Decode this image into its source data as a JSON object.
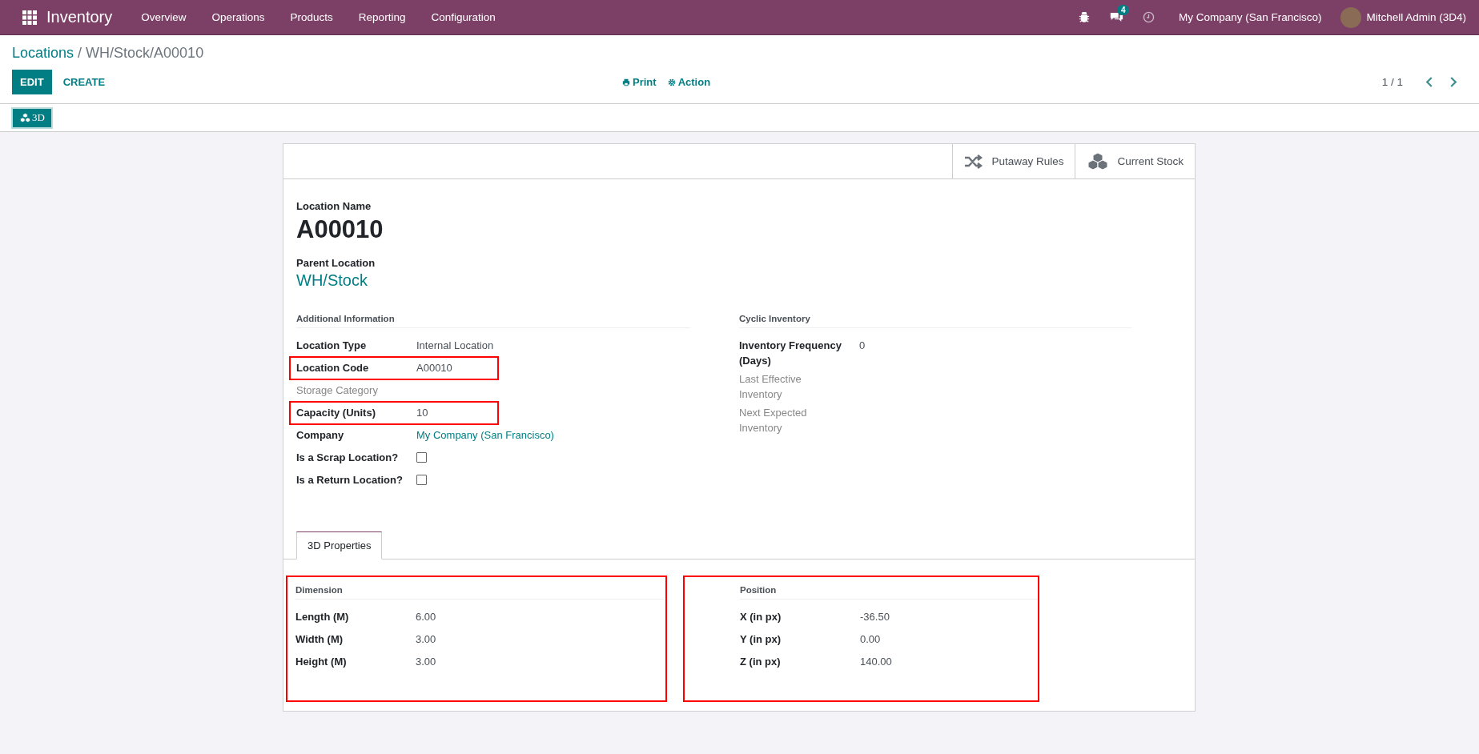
{
  "navbar": {
    "app_title": "Inventory",
    "menu": [
      "Overview",
      "Operations",
      "Products",
      "Reporting",
      "Configuration"
    ],
    "messages_count": "4",
    "company": "My Company (San Francisco)",
    "user": "Mitchell Admin (3D4)"
  },
  "breadcrumb": {
    "parent": "Locations",
    "separator": "/",
    "current": "WH/Stock/A00010"
  },
  "control_panel": {
    "buttons": [
      {
        "label": "EDIT",
        "kind": "primary"
      },
      {
        "label": "CREATE",
        "kind": "link"
      }
    ],
    "actions": [
      {
        "label": "Print",
        "kind": "print"
      },
      {
        "label": "Action",
        "kind": "gear"
      }
    ],
    "pager": "1 / 1"
  },
  "view_switch": {
    "label": "3D",
    "selected": true
  },
  "smart_buttons": [
    {
      "label": "Putaway Rules",
      "kind": "shuffle"
    },
    {
      "label": "Current Stock",
      "kind": "cubes"
    }
  ],
  "form": {
    "name_label": "Location Name",
    "name": "A00010",
    "parent_label": "Parent Location",
    "parent": "WH/Stock",
    "groups": [
      {
        "title": "Additional Information",
        "fields": [
          {
            "kind": "text",
            "label": "Location Type",
            "value": "Internal Location",
            "highlighted": false
          },
          {
            "kind": "text",
            "label": "Location Code",
            "value": "A00010",
            "highlighted": true
          },
          {
            "kind": "muted",
            "label": "Storage Category",
            "highlighted": false
          },
          {
            "kind": "text",
            "label": "Capacity (Units)",
            "value": "10",
            "highlighted": true
          },
          {
            "kind": "link",
            "label": "Company",
            "value": "My Company (San Francisco)",
            "highlighted": false
          },
          {
            "kind": "checkbox",
            "label": "Is a Scrap Location?",
            "checked": false,
            "highlighted": false
          },
          {
            "kind": "checkbox",
            "label": "Is a Return Location?",
            "checked": false,
            "highlighted": false
          }
        ]
      },
      {
        "title": "Cyclic Inventory",
        "fields": [
          {
            "kind": "text",
            "label": "Inventory Frequency (Days)",
            "value": "0",
            "highlighted": false
          },
          {
            "kind": "muted",
            "label": "Last Effective Inventory",
            "highlighted": false
          },
          {
            "kind": "muted",
            "label": "Next Expected Inventory",
            "highlighted": false
          }
        ]
      }
    ],
    "tabs": [
      {
        "label": "3D Properties",
        "selected": true
      }
    ],
    "tab_groups": [
      {
        "title": "Dimension",
        "highlighted": true,
        "fields": [
          {
            "label": "Length (M)",
            "value": "6.00"
          },
          {
            "label": "Width (M)",
            "value": "3.00"
          },
          {
            "label": "Height (M)",
            "value": "3.00"
          }
        ]
      },
      {
        "title": "Position",
        "highlighted": true,
        "fields": [
          {
            "label": "X (in px)",
            "value": "-36.50"
          },
          {
            "label": "Y (in px)",
            "value": "0.00"
          },
          {
            "label": "Z (in px)",
            "value": "140.00"
          }
        ]
      }
    ]
  }
}
